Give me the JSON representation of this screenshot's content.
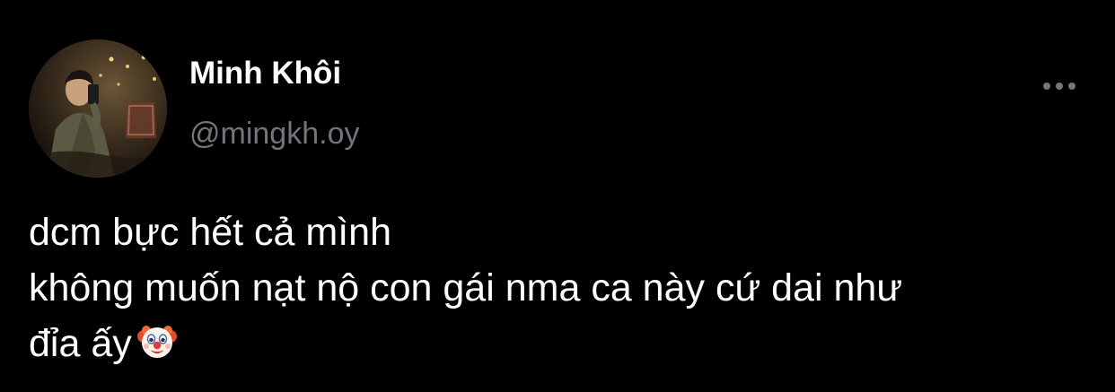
{
  "author": {
    "display_name": "Minh Khôi",
    "handle": "@mingkh.oy",
    "avatar_icon": "profile-photo"
  },
  "actions": {
    "more_icon": "more-horizontal-icon"
  },
  "tweet": {
    "lines": [
      "dcm bực hết cả mình",
      "không muốn nạt nộ con gái nma ca này cứ dai như",
      "đỉa ấy"
    ],
    "emoji": "clown-face"
  },
  "colors": {
    "background": "#000000",
    "text": "#ffffff",
    "secondary": "#71767b"
  }
}
